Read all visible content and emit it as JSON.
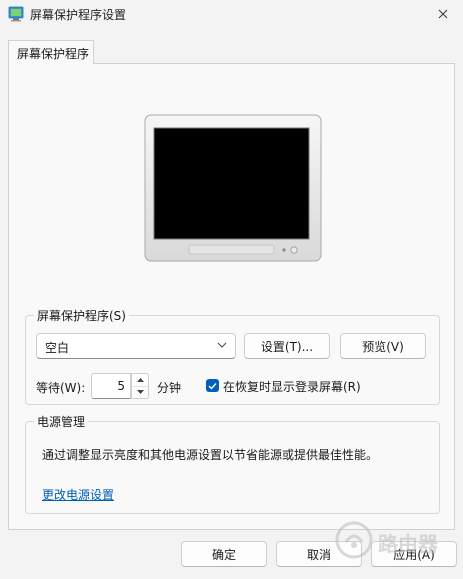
{
  "window": {
    "title": "屏幕保护程序设置"
  },
  "tabs": [
    {
      "label": "屏幕保护程序"
    }
  ],
  "screensaver": {
    "group_label": "屏幕保护程序(S)",
    "selected": "空白",
    "settings_button": "设置(T)...",
    "preview_button": "预览(V)",
    "wait_label": "等待(W):",
    "wait_value": "5",
    "wait_unit": "分钟",
    "resume_checkbox_label": "在恢复时显示登录屏幕(R)",
    "resume_checked": true
  },
  "power": {
    "group_label": "电源管理",
    "description": "通过调整显示亮度和其他电源设置以节省能源或提供最佳性能。",
    "link": "更改电源设置"
  },
  "footer": {
    "ok": "确定",
    "cancel": "取消",
    "apply": "应用(A)"
  },
  "watermark": {
    "text": "路由器"
  },
  "colors": {
    "accent": "#005fb8",
    "monitor_screen": "#000000"
  }
}
